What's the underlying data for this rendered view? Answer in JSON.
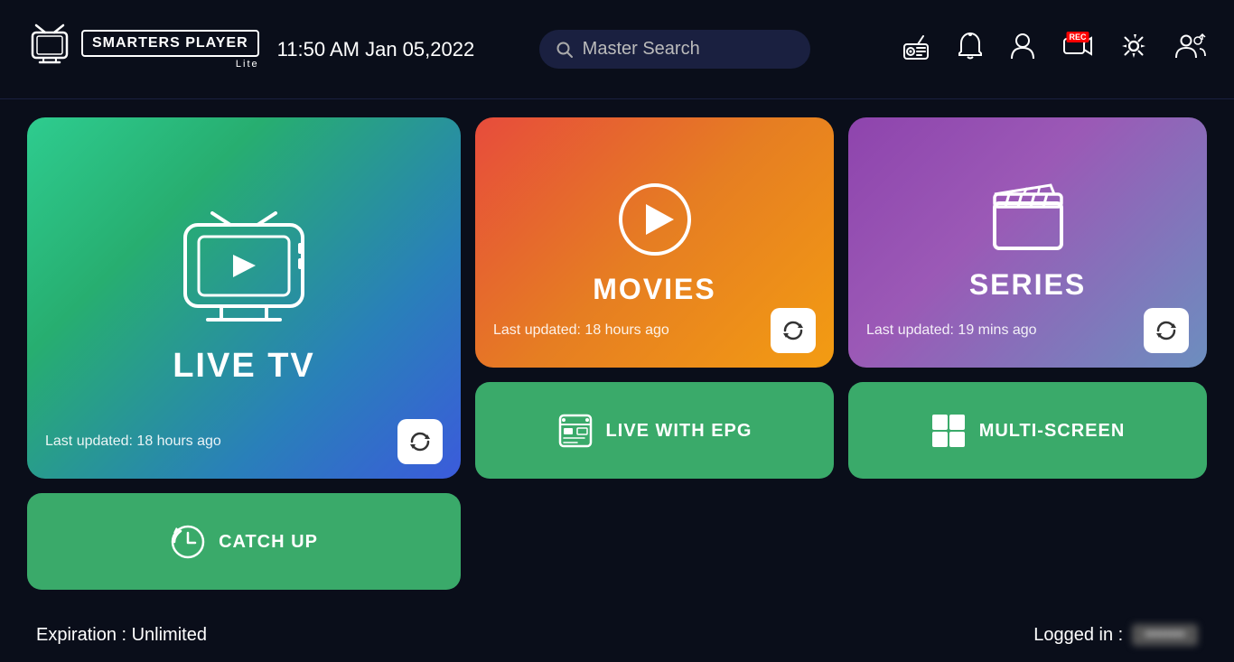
{
  "header": {
    "logo_main": "SMARTERS PLAYER",
    "logo_sub": "Lite",
    "datetime": "11:50 AM  Jan 05,2022",
    "search_placeholder": "Master Search"
  },
  "icons": {
    "radio": "📻",
    "notification": "🔔",
    "profile": "👤",
    "record": "📹",
    "settings": "⚙",
    "users": "👥"
  },
  "cards": {
    "live_tv": {
      "title": "LIVE TV",
      "last_updated": "Last updated: 18 hours ago"
    },
    "movies": {
      "title": "MOVIES",
      "last_updated": "Last updated: 18 hours ago"
    },
    "series": {
      "title": "SERIES",
      "last_updated": "Last updated: 19 mins ago"
    },
    "live_with_epg": {
      "title": "LIVE WITH EPG"
    },
    "multi_screen": {
      "title": "MULTI-SCREEN"
    },
    "catch_up": {
      "title": "CATCH UP"
    }
  },
  "footer": {
    "expiration": "Expiration : Unlimited",
    "logged_in_label": "Logged in :",
    "logged_in_user": "••••••••"
  }
}
